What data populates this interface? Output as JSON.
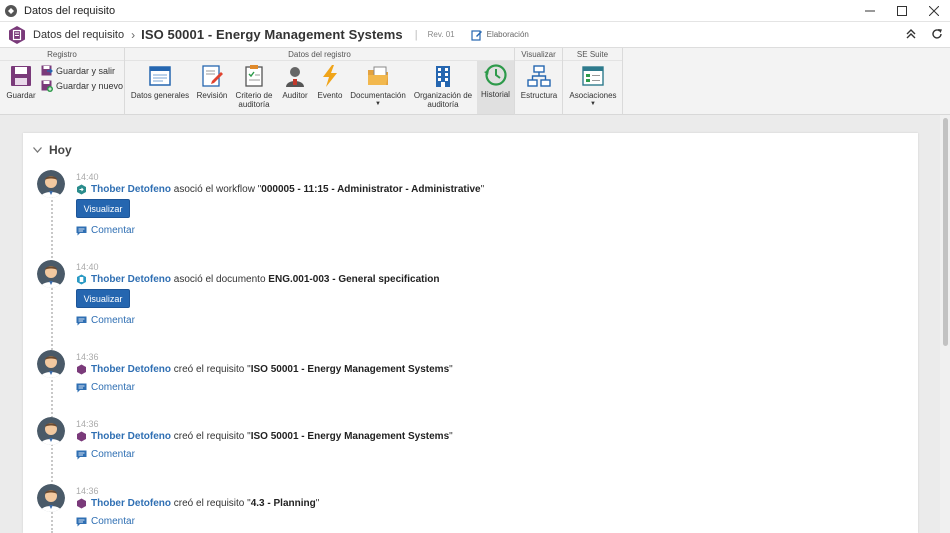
{
  "window": {
    "title": "Datos del requisito"
  },
  "header": {
    "crumb": "Datos del requisito",
    "title": "ISO 50001 - Energy Management Systems",
    "rev": "Rev. 01",
    "stage": "Elaboración"
  },
  "ribbon": {
    "groups": {
      "registro": "Registro",
      "datos": "Datos del registro",
      "visualizar": "Visualizar",
      "suite": "SE Suite"
    },
    "guardar": "Guardar",
    "guardar_salir": "Guardar y salir",
    "guardar_nuevo": "Guardar y nuevo",
    "datos_generales": "Datos generales",
    "revision": "Revisión",
    "criterio_1": "Criterio de",
    "criterio_2": "auditoría",
    "auditor": "Auditor",
    "evento": "Evento",
    "documentacion": "Documentación",
    "organizacion_1": "Organización de",
    "organizacion_2": "auditoría",
    "historial": "Historial",
    "estructura": "Estructura",
    "asociaciones": "Asociaciones"
  },
  "timeline": {
    "section": "Hoy",
    "view_button": "Visualizar",
    "comment_label": "Comentar",
    "entries": [
      {
        "time": "14:40",
        "user": "Thober Detofeno",
        "action": "asoció el workflow",
        "q1": "\"",
        "object": "000005 - 11:15 - Administrator - Administrative",
        "q2": "\""
      },
      {
        "time": "14:40",
        "user": "Thober Detofeno",
        "action": "asoció el documento",
        "q1": "",
        "object": "ENG.001-003 - General specification",
        "q2": ""
      },
      {
        "time": "14:36",
        "user": "Thober Detofeno",
        "action": "creó el requisito",
        "q1": "\"",
        "object": "ISO 50001 - Energy Management Systems",
        "q2": "\""
      },
      {
        "time": "14:36",
        "user": "Thober Detofeno",
        "action": "creó el requisito",
        "q1": "\"",
        "object": "ISO 50001 - Energy Management Systems",
        "q2": "\""
      },
      {
        "time": "14:36",
        "user": "Thober Detofeno",
        "action": "creó el requisito",
        "q1": "\"",
        "object": "4.3 - Planning",
        "q2": "\""
      }
    ]
  },
  "colors": {
    "accent": "#2566b0",
    "link": "#2f6fb3",
    "module": "#7a3a7a"
  }
}
